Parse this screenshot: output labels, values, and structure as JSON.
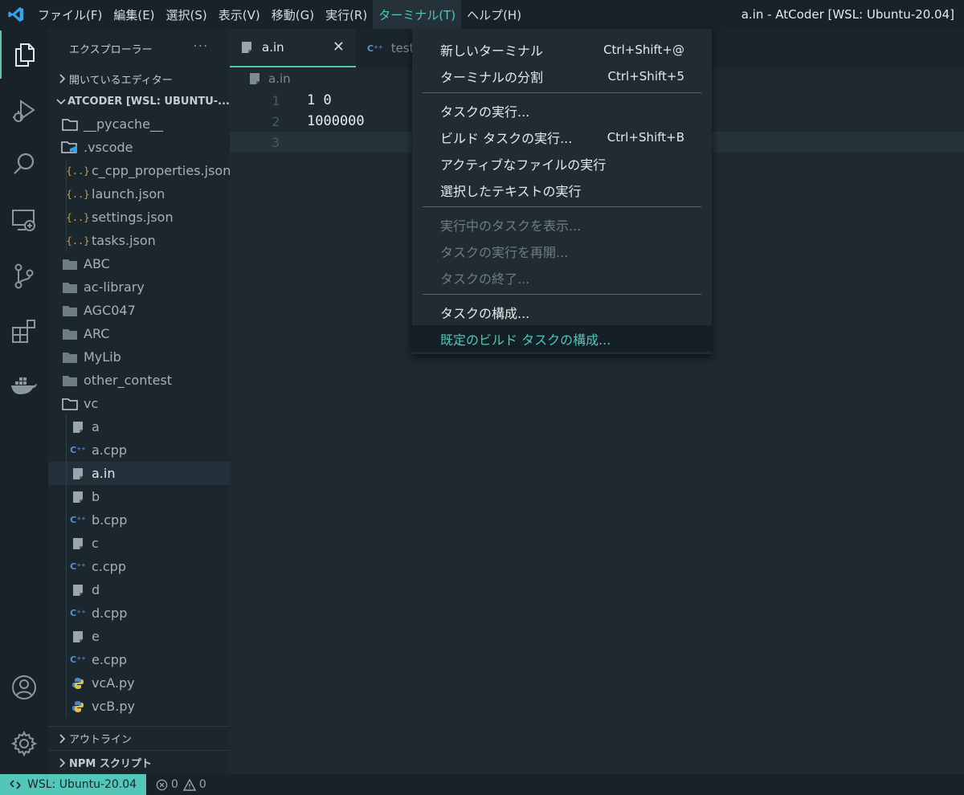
{
  "menubar": {
    "items": [
      "ファイル(F)",
      "編集(E)",
      "選択(S)",
      "表示(V)",
      "移動(G)",
      "実行(R)",
      "ターミナル(T)",
      "ヘルプ(H)"
    ],
    "window_title": "a.in - AtCoder [WSL: Ubuntu-20.04]"
  },
  "sidebar": {
    "title": "エクスプローラー",
    "more": "···",
    "open_editors": "開いているエディター",
    "workspace": "ATCODER [WSL: UBUNTU-...",
    "tree": [
      {
        "label": "__pycache__",
        "icon": "folder-outline-icon"
      },
      {
        "label": ".vscode",
        "icon": "vscode-folder-icon"
      },
      {
        "label": "c_cpp_properties.json",
        "icon": "json-icon"
      },
      {
        "label": "launch.json",
        "icon": "json-icon"
      },
      {
        "label": "settings.json",
        "icon": "json-icon"
      },
      {
        "label": "tasks.json",
        "icon": "json-icon"
      },
      {
        "label": "ABC",
        "icon": "folder-icon"
      },
      {
        "label": "ac-library",
        "icon": "folder-icon"
      },
      {
        "label": "AGC047",
        "icon": "folder-icon"
      },
      {
        "label": "ARC",
        "icon": "folder-icon"
      },
      {
        "label": "MyLib",
        "icon": "folder-icon"
      },
      {
        "label": "other_contest",
        "icon": "folder-icon"
      },
      {
        "label": "vc",
        "icon": "folder-outline-icon"
      },
      {
        "label": "a",
        "icon": "file-icon"
      },
      {
        "label": "a.cpp",
        "icon": "cpp-icon"
      },
      {
        "label": "a.in",
        "icon": "file-icon"
      },
      {
        "label": "b",
        "icon": "file-icon"
      },
      {
        "label": "b.cpp",
        "icon": "cpp-icon"
      },
      {
        "label": "c",
        "icon": "file-icon"
      },
      {
        "label": "c.cpp",
        "icon": "cpp-icon"
      },
      {
        "label": "d",
        "icon": "file-icon"
      },
      {
        "label": "d.cpp",
        "icon": "cpp-icon"
      },
      {
        "label": "e",
        "icon": "file-icon"
      },
      {
        "label": "e.cpp",
        "icon": "cpp-icon"
      },
      {
        "label": "vcA.py",
        "icon": "python-icon"
      },
      {
        "label": "vcB.py",
        "icon": "python-icon"
      }
    ],
    "outline": "アウトライン",
    "npm": "NPM スクリプト"
  },
  "editor": {
    "tabs": [
      {
        "label": "a.in",
        "active": true
      },
      {
        "label": "test",
        "active": false
      }
    ],
    "close": "✕",
    "breadcrumb": "a.in",
    "lines": [
      {
        "n": "1",
        "text": "1 0"
      },
      {
        "n": "2",
        "text": "1000000"
      },
      {
        "n": "3",
        "text": ""
      }
    ]
  },
  "terminal_menu": {
    "groups": [
      [
        {
          "label": "新しいターミナル",
          "shortcut": "Ctrl+Shift+@"
        },
        {
          "label": "ターミナルの分割",
          "shortcut": "Ctrl+Shift+5"
        }
      ],
      [
        {
          "label": "タスクの実行...",
          "shortcut": ""
        },
        {
          "label": "ビルド タスクの実行...",
          "shortcut": "Ctrl+Shift+B"
        },
        {
          "label": "アクティブなファイルの実行",
          "shortcut": ""
        },
        {
          "label": "選択したテキストの実行",
          "shortcut": ""
        }
      ],
      [
        {
          "label": "実行中のタスクを表示...",
          "shortcut": ""
        },
        {
          "label": "タスクの実行を再開...",
          "shortcut": ""
        },
        {
          "label": "タスクの終了...",
          "shortcut": ""
        }
      ],
      [
        {
          "label": "タスクの構成...",
          "shortcut": ""
        },
        {
          "label": "既定のビルド タスクの構成...",
          "shortcut": ""
        }
      ]
    ]
  },
  "statusbar": {
    "remote": "WSL: Ubuntu-20.04",
    "errors": "0",
    "warnings": "0"
  },
  "colors": {
    "accent": "#52c7b8",
    "background": "#1e2a30",
    "cpp": "#5a8fd8",
    "json": "#c7a15a"
  }
}
